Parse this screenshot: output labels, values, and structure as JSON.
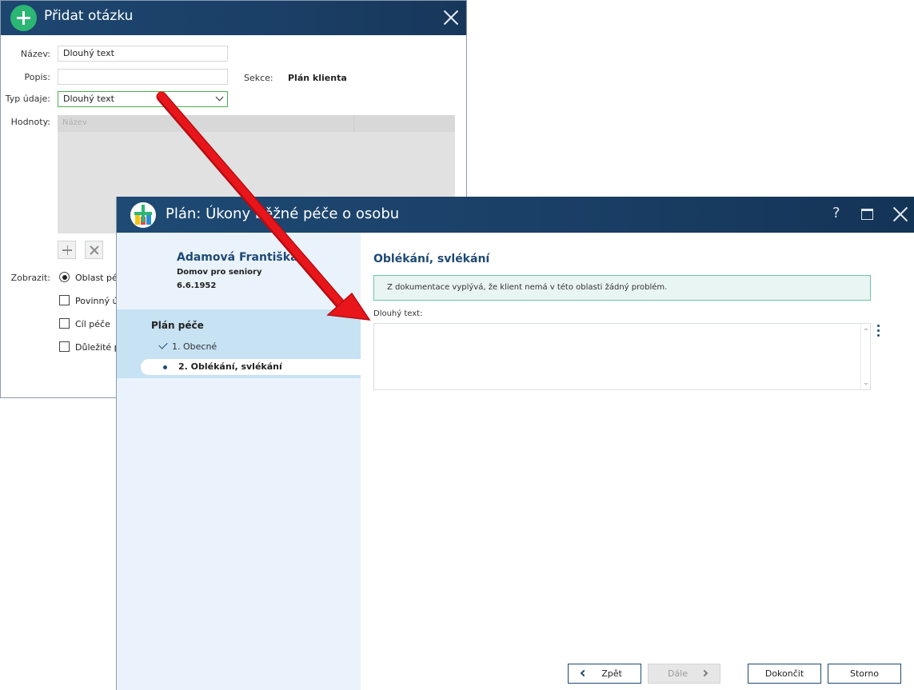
{
  "back_dialog": {
    "title": "Přidat otázku",
    "fields": {
      "name_label": "Název:",
      "name_value": "Dlouhý text",
      "desc_label": "Popis:",
      "desc_value": "",
      "type_label": "Typ údaje:",
      "type_value": "Dlouhý text",
      "values_label": "Hodnoty:",
      "values_col_header": "Název",
      "section_label": "Sekce:",
      "section_value": "Plán klienta"
    },
    "display": {
      "label": "Zobrazit:",
      "options": [
        {
          "label": "Oblast péč",
          "type": "radio",
          "checked": true
        },
        {
          "label": "Povinný ú",
          "type": "checkbox",
          "checked": false
        },
        {
          "label": "Cíl péče",
          "type": "checkbox",
          "checked": false
        },
        {
          "label": "Důležité p",
          "type": "checkbox",
          "checked": false
        }
      ]
    }
  },
  "front_dialog": {
    "title": "Plán: Úkony běžné péče o osobu",
    "titlebar_help": "?",
    "client": {
      "name": "Adamová Františka",
      "organization": "Domov pro seniory",
      "birth_date": "6.6.1952"
    },
    "nav": {
      "section_title": "Plán péče",
      "steps": [
        {
          "label": "1. Obecné",
          "state": "done"
        },
        {
          "label": "2. Oblékání, svlékání",
          "state": "current"
        }
      ]
    },
    "main": {
      "heading": "Oblékání, svlékání",
      "info_message": "Z dokumentace vyplývá, že klient nemá v této oblasti žádný problém.",
      "field_label": "Dlouhý text:",
      "field_value": ""
    },
    "buttons": {
      "back": "Zpět",
      "next": "Dále",
      "finish": "Dokončit",
      "cancel": "Storno"
    }
  },
  "colors": {
    "titlebar": "#1b3f66",
    "accent": "#1e4a74",
    "green": "#2bb673",
    "sidebar_bg": "#eaf3fb",
    "sidebar_section": "#c6e2f3",
    "info_bg": "#e9f5f2",
    "info_border": "#6cc3a7",
    "annotation_arrow": "#e8161b"
  },
  "annotation": {
    "type": "arrow"
  }
}
